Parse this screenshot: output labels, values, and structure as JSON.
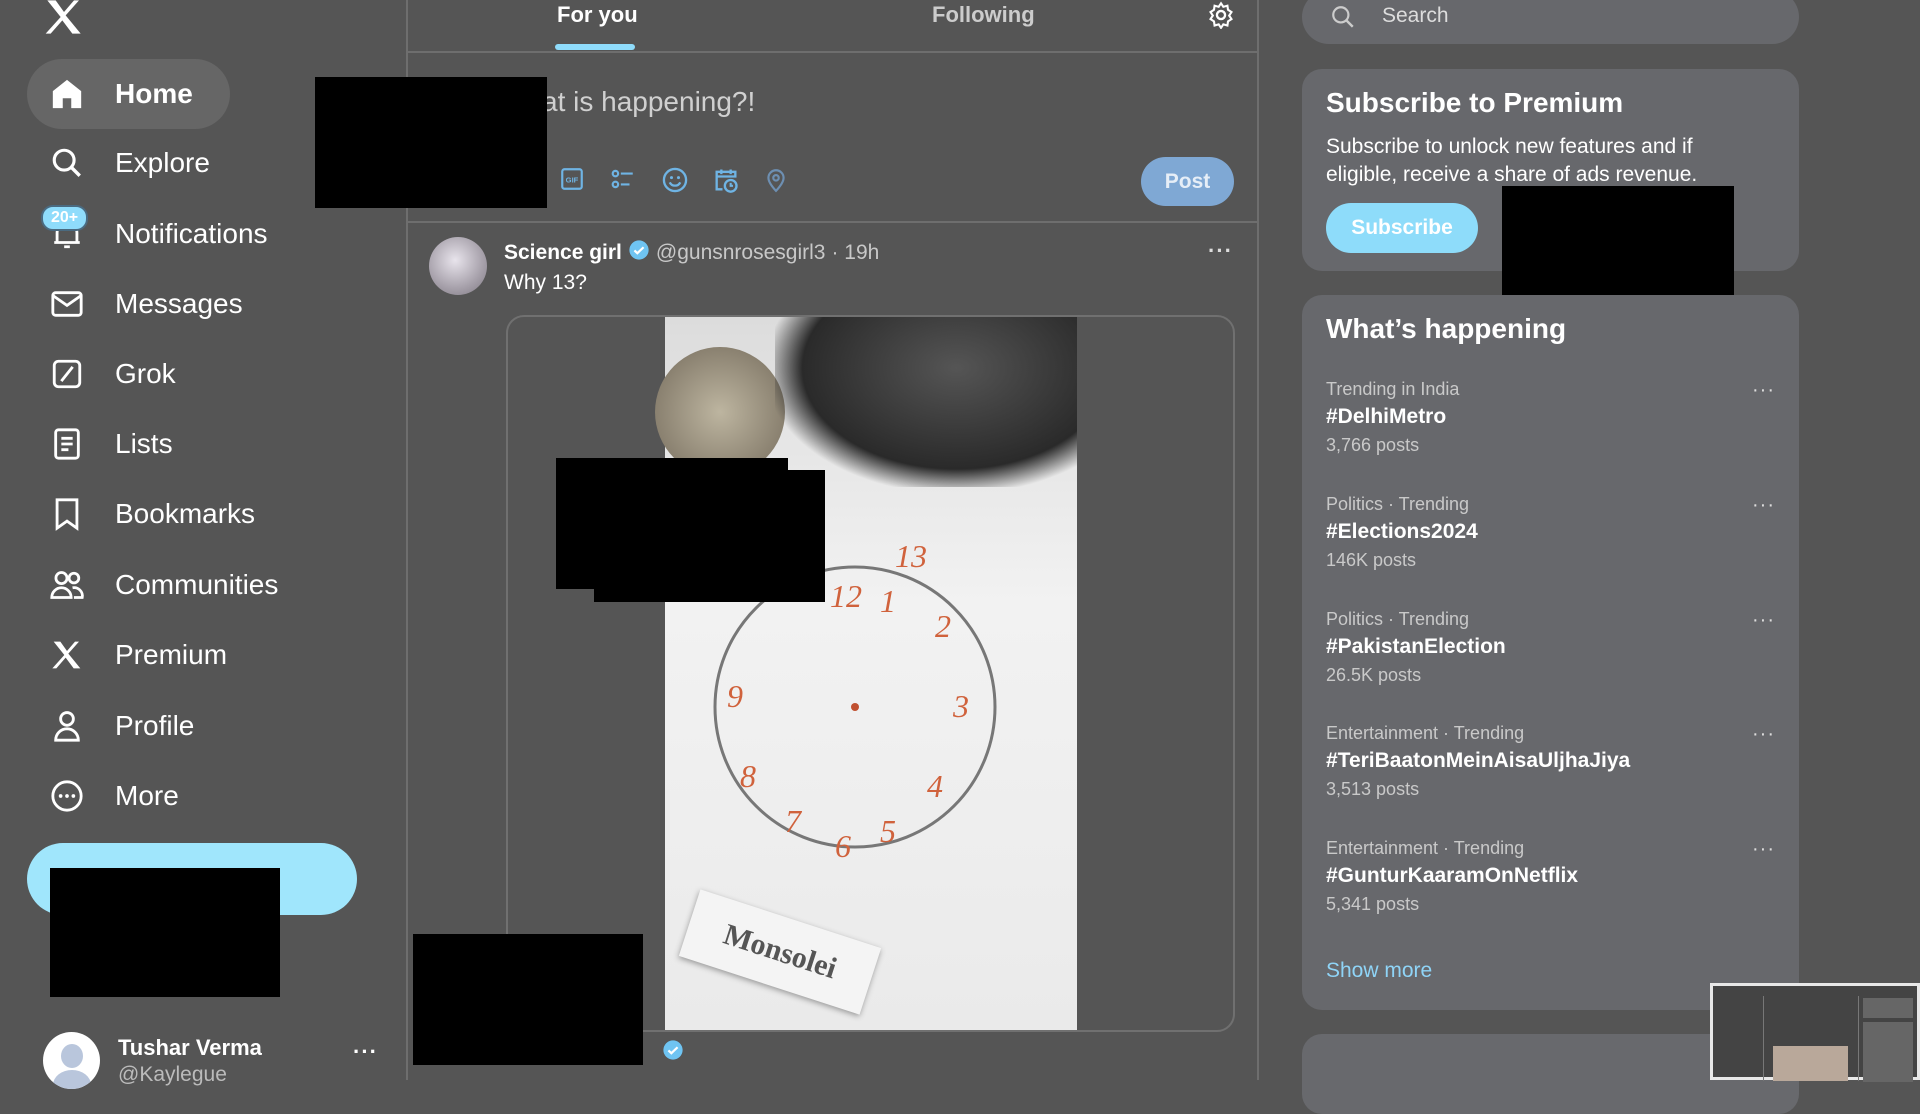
{
  "sidebar": {
    "logo": "x-logo",
    "items": [
      {
        "label": "Home",
        "icon": "home-icon"
      },
      {
        "label": "Explore",
        "icon": "search-icon"
      },
      {
        "label": "Notifications",
        "icon": "bell-icon",
        "badge": "20+"
      },
      {
        "label": "Messages",
        "icon": "envelope-icon"
      },
      {
        "label": "Grok",
        "icon": "grok-icon"
      },
      {
        "label": "Lists",
        "icon": "list-icon"
      },
      {
        "label": "Bookmarks",
        "icon": "bookmark-icon"
      },
      {
        "label": "Communities",
        "icon": "people-icon"
      },
      {
        "label": "Premium",
        "icon": "x-icon"
      },
      {
        "label": "Profile",
        "icon": "person-icon"
      },
      {
        "label": "More",
        "icon": "more-circle-icon"
      }
    ],
    "user": {
      "name": "Tushar Verma",
      "handle": "@Kaylegue"
    }
  },
  "main": {
    "tabs": [
      {
        "label": "For you",
        "active": true
      },
      {
        "label": "Following",
        "active": false
      }
    ],
    "composer": {
      "placeholder": "What is happening?!",
      "post_label": "Post"
    },
    "tweet": {
      "name": "Science girl",
      "handle": "@gunsnrosesgirl3",
      "time": "· 19h",
      "text": "Why 13?",
      "media_label": "Monsolei"
    }
  },
  "right": {
    "search_placeholder": "Search",
    "premium": {
      "title": "Subscribe to Premium",
      "text": "Subscribe to unlock new features and if eligible, receive a share of ads revenue.",
      "button": "Subscribe"
    },
    "trends": {
      "title": "What’s happening",
      "items": [
        {
          "meta": "Trending in India",
          "tag": "#DelhiMetro",
          "count": "3,766 posts"
        },
        {
          "meta": "Politics · Trending",
          "tag": "#Elections2024",
          "count": "146K posts"
        },
        {
          "meta": "Politics · Trending",
          "tag": "#PakistanElection",
          "count": "26.5K posts"
        },
        {
          "meta": "Entertainment · Trending",
          "tag": "#TeriBaatonMeinAisaUljhaJiya",
          "count": "3,513 posts"
        },
        {
          "meta": "Entertainment · Trending",
          "tag": "#GunturKaaramOnNetflix",
          "count": "5,341 posts"
        }
      ],
      "show_more": "Show more"
    }
  },
  "colors": {
    "background": "#555555",
    "accent": "#8fdcfb",
    "card": "#67686c"
  }
}
